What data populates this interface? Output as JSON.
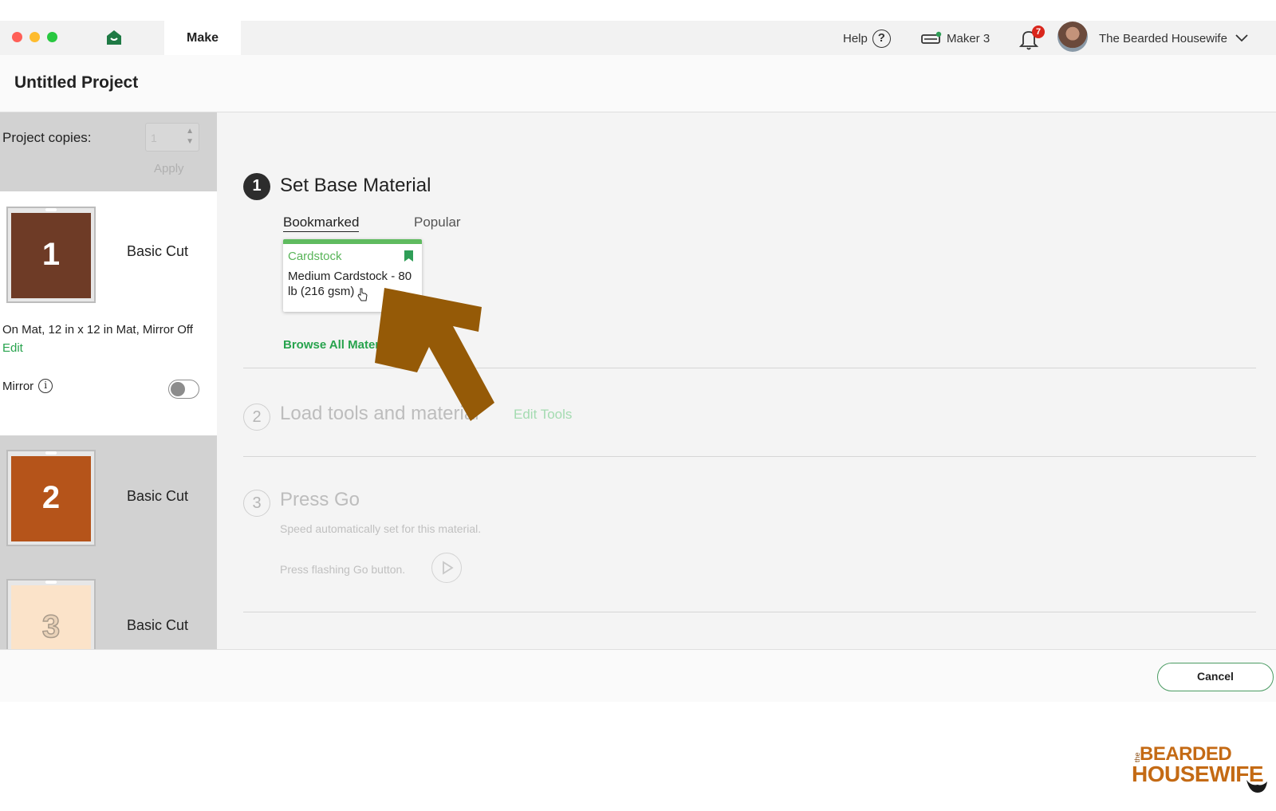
{
  "app": {
    "home_icon": "home-icon",
    "active_tab": "Make"
  },
  "topbar": {
    "help_label": "Help",
    "help_icon": "question-circle-icon",
    "machine_label": "Maker 3",
    "machine_icon": "cutting-machine-icon",
    "notification_count": "7",
    "user_name": "The Bearded Housewife"
  },
  "project": {
    "title": "Untitled Project"
  },
  "sidebar": {
    "copies_label": "Project copies:",
    "copies_value": "1",
    "apply_label": "Apply",
    "mats": [
      {
        "number": "1",
        "label": "Basic Cut",
        "color": "#6e3b26"
      },
      {
        "number": "2",
        "label": "Basic Cut",
        "color": "#b5541a"
      },
      {
        "number": "3",
        "label": "Basic Cut",
        "color": "#fbe3c9"
      }
    ],
    "mat_info": "On Mat, 12 in x 12 in Mat, Mirror Off",
    "edit_label": "Edit",
    "mirror_label": "Mirror",
    "mirror_on": false
  },
  "steps": {
    "step1": {
      "number": "1",
      "title": "Set Base Material",
      "tabs": [
        "Bookmarked",
        "Popular"
      ],
      "card": {
        "category": "Cardstock",
        "name": "Medium Cardstock - 80 lb (216 gsm)"
      },
      "browse_label": "Browse All Materials"
    },
    "step2": {
      "number": "2",
      "title": "Load tools and material",
      "edit_tools": "Edit Tools"
    },
    "step3": {
      "number": "3",
      "title": "Press Go",
      "speed_note": "Speed automatically set for this material.",
      "press_note": "Press flashing Go button."
    }
  },
  "footer": {
    "cancel_label": "Cancel"
  },
  "watermark": {
    "small": "the",
    "line1": "BEARDED",
    "line2": "HOUSEWIFE"
  },
  "colors": {
    "accent_green": "#27a34d",
    "card_green": "#5fbb5f",
    "arrow_brown": "#955a07"
  }
}
